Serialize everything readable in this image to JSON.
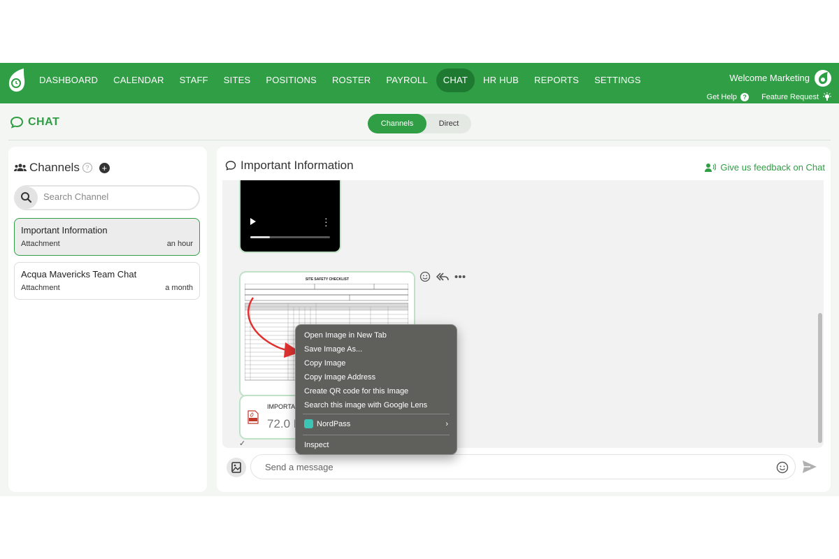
{
  "nav": {
    "items": [
      "DASHBOARD",
      "CALENDAR",
      "STAFF",
      "SITES",
      "POSITIONS",
      "ROSTER",
      "PAYROLL",
      "CHAT",
      "HR HUB",
      "REPORTS",
      "SETTINGS"
    ],
    "active": "CHAT",
    "welcome": "Welcome Marketing",
    "get_help": "Get Help",
    "feature_request": "Feature Request"
  },
  "chat": {
    "title": "CHAT",
    "tabs": {
      "channels": "Channels",
      "direct": "Direct"
    }
  },
  "channels_panel": {
    "title": "Channels",
    "search_placeholder": "Search Channel",
    "channels": [
      {
        "name": "Important Information",
        "subtitle": "Attachment",
        "time": "an hour"
      },
      {
        "name": "Acqua Mavericks Team Chat",
        "subtitle": "Attachment",
        "time": "a month"
      }
    ]
  },
  "conversation": {
    "title": "Important Information",
    "feedback": "Give us feedback on Chat",
    "document_title": "SITE SAFETY CHECKLIST",
    "attachment_name": "IMPORTAN",
    "attachment_size": "72.0 K",
    "message_placeholder": "Send a message"
  },
  "context_menu": {
    "items": [
      "Open Image in New Tab",
      "Save Image As...",
      "Copy Image",
      "Copy Image Address",
      "Create QR code for this Image",
      "Search this image with Google Lens"
    ],
    "extension": "NordPass",
    "inspect": "Inspect"
  },
  "colors": {
    "brand_green": "#2f9e44",
    "active_nav": "#1e7a31",
    "menu_bg": "#5f5f5c"
  }
}
